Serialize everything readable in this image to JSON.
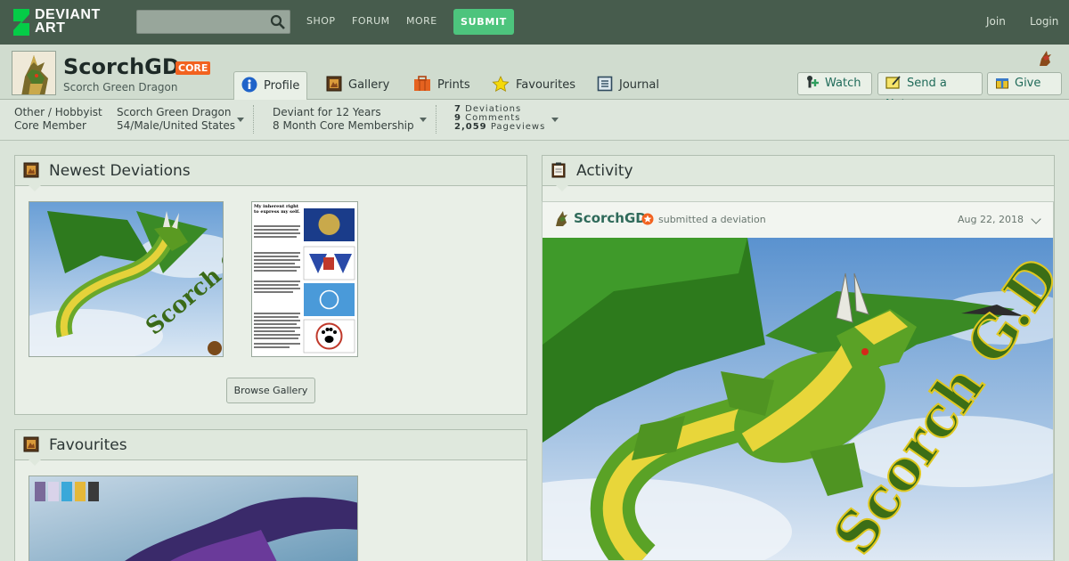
{
  "logo": {
    "line1": "DEVIANT",
    "line2": "ART"
  },
  "search": {
    "placeholder": ""
  },
  "nav": {
    "shop": "SHOP",
    "forum": "FORUM",
    "more": "MORE",
    "submit": "SUBMIT",
    "join": "Join",
    "login": "Login"
  },
  "profile": {
    "username": "ScorchGD",
    "badge": "CORE",
    "tagline": "Scorch Green Dragon"
  },
  "tabs": [
    {
      "label": "Profile",
      "icon": "profile-icon",
      "active": true
    },
    {
      "label": "Gallery",
      "icon": "gallery-icon"
    },
    {
      "label": "Prints",
      "icon": "prints-icon"
    },
    {
      "label": "Favourites",
      "icon": "star-icon"
    },
    {
      "label": "Journal",
      "icon": "journal-icon"
    }
  ],
  "actions": {
    "watch": "Watch",
    "note": "Send a Note",
    "give": "Give"
  },
  "info": {
    "type": "Other / Hobbyist",
    "membership": "Core Member",
    "name": "Scorch Green Dragon",
    "details": "54/Male/United States",
    "deviant_for": "Deviant for 12 Years",
    "core_duration": "8 Month Core Membership",
    "stats": [
      {
        "value": "7",
        "label": "Deviations"
      },
      {
        "value": "9",
        "label": "Comments"
      },
      {
        "value": "2,059",
        "label": "Pageviews"
      }
    ]
  },
  "newest": {
    "title": "Newest Deviations",
    "browse": "Browse Gallery",
    "doc_title": "My inherent right to express my self.",
    "caption": "Scorch G.D."
  },
  "favourites": {
    "title": "Favourites"
  },
  "activity": {
    "title": "Activity",
    "user": "ScorchGD",
    "verb": "submitted a deviation",
    "date": "Aug 22, 2018",
    "caption": "Scorch G.D."
  },
  "colors": {
    "topbar": "#475c4d",
    "accent_green": "#4dc47d",
    "core_orange": "#f2621f",
    "link": "#2f6a5a"
  }
}
